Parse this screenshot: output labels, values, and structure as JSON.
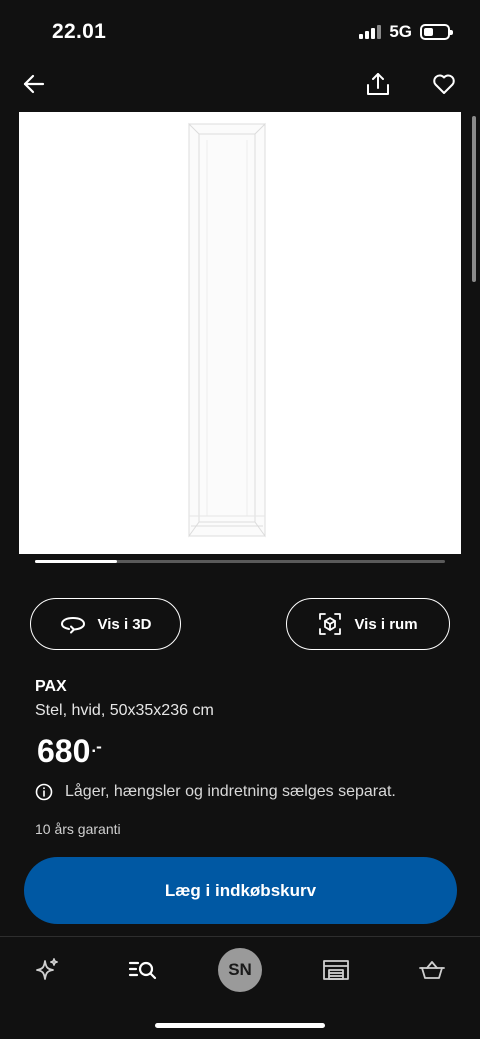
{
  "status_bar": {
    "time": "22.01",
    "network": "5G",
    "battery_level": 0.4
  },
  "top_bar": {
    "back_icon": "arrow-left-icon",
    "share_icon": "share-icon",
    "favorite_icon": "heart-icon"
  },
  "product_image": {
    "name": "PAX frame",
    "icon": "wardrobe-frame-image"
  },
  "carousel": {
    "progress": 0.2
  },
  "actions": {
    "view_3d_label": "Vis i 3D",
    "view_room_label": "Vis i rum"
  },
  "product": {
    "name": "PAX",
    "description": "Stel, hvid, 50x35x236 cm",
    "price": "680",
    "price_suffix": ".-",
    "info_note": "Låger, hængsler og indretning sælges separat.",
    "warranty": "10 års garanti"
  },
  "cart_button_label": "Læg i indkøbskurv",
  "tab_bar": {
    "items": [
      {
        "id": "inspire",
        "icon": "sparkle-icon"
      },
      {
        "id": "search",
        "icon": "search-list-icon"
      },
      {
        "id": "profile",
        "initials": "SN"
      },
      {
        "id": "store",
        "icon": "store-icon"
      },
      {
        "id": "cart",
        "icon": "basket-icon"
      }
    ]
  },
  "colors": {
    "background": "#111111",
    "accent": "#0058a3",
    "text": "#ffffff"
  }
}
